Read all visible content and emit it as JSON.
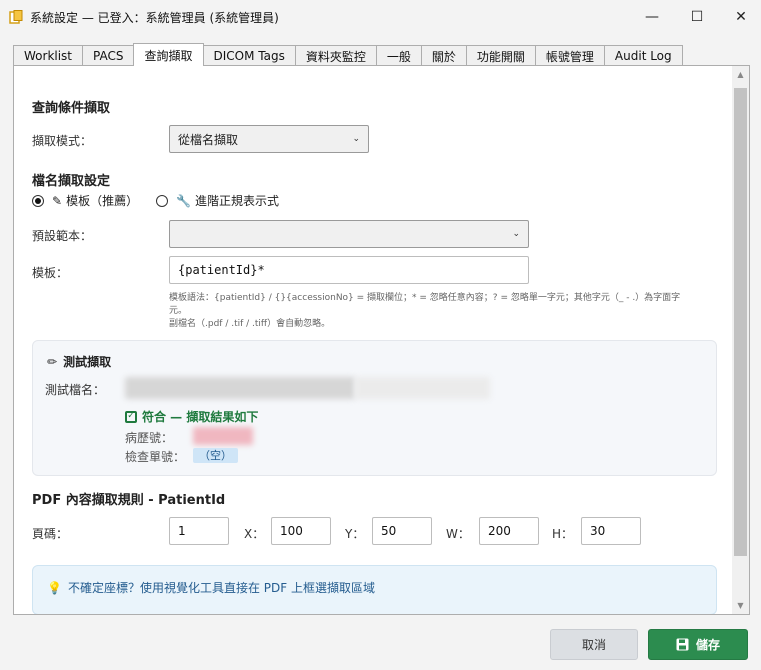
{
  "window": {
    "title": "系統設定 — 已登入：系統管理員 (系統管理員)",
    "minimize_glyph": "—",
    "maximize_glyph": "☐",
    "close_glyph": "✕"
  },
  "tabs": [
    {
      "label": "Worklist"
    },
    {
      "label": "PACS"
    },
    {
      "label": "查詢擷取",
      "active": true
    },
    {
      "label": "DICOM Tags"
    },
    {
      "label": "資料夾監控"
    },
    {
      "label": "一般"
    },
    {
      "label": "關於"
    },
    {
      "label": "功能開關"
    },
    {
      "label": "帳號管理"
    },
    {
      "label": "Audit Log"
    }
  ],
  "query": {
    "section_title": "查詢條件擷取",
    "mode_label": "擷取模式：",
    "mode_value": "從檔名擷取"
  },
  "filename": {
    "section_title": "檔名擷取設定",
    "radio_template": "模板（推薦）",
    "radio_regex": "進階正規表示式",
    "preset_label": "預設範本：",
    "preset_value": "",
    "template_label": "模板：",
    "template_value": "{patientId}*",
    "hint_line1": "模板語法：{patientId} / {}{accessionNo} = 擷取欄位；* = 忽略任意內容；? = 忽略單一字元；其他字元（_ - .）為字面字",
    "hint_line2": "元。",
    "hint_line3": "副檔名（.pdf / .tif / .tiff）會自動忽略。"
  },
  "test": {
    "title": "測試擷取",
    "filename_label": "測試檔名：",
    "match_text": "符合 — 擷取結果如下",
    "patient_label": "病歷號：",
    "accession_label": "檢查單號：",
    "accession_value": "（空）"
  },
  "pdf": {
    "section_title": "PDF 內容擷取規則 - PatientId",
    "page_label": "頁碼：",
    "page_value": "1",
    "x_label": "X：",
    "x_value": "100",
    "y_label": "Y：",
    "y_value": "50",
    "w_label": "W：",
    "w_value": "200",
    "h_label": "H：",
    "h_value": "30"
  },
  "info": {
    "text": "不確定座標？使用視覺化工具直接在 PDF 上框選擷取區域"
  },
  "footer": {
    "cancel": "取消",
    "save": "儲存"
  },
  "colors": {
    "accent_green": "#2c8c4f",
    "info_blue": "#245c8f"
  }
}
